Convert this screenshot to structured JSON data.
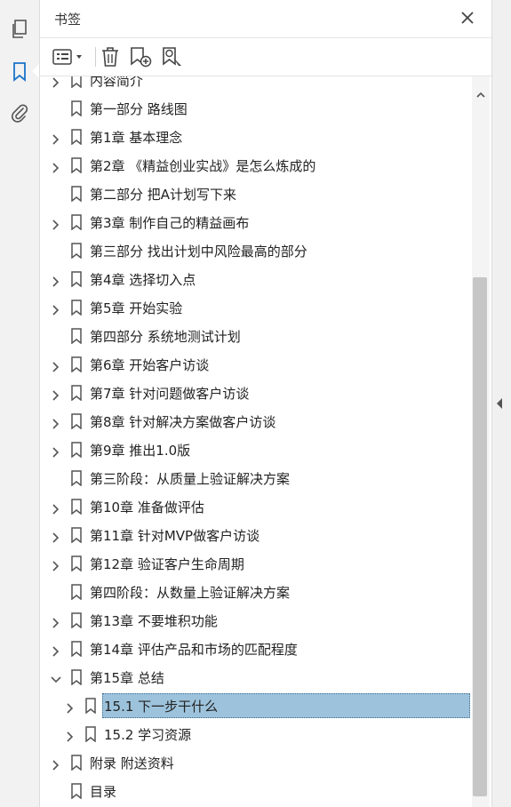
{
  "panel": {
    "title": "书签"
  },
  "rail": {
    "icons": [
      "pages-icon",
      "bookmark-icon",
      "attachment-icon"
    ],
    "active": "bookmark-icon"
  },
  "toolbar": {
    "icons": [
      "options-menu-icon",
      "delete-icon",
      "new-bookmark-icon",
      "find-bookmark-icon"
    ]
  },
  "colors": {
    "accent": "#1a73c9",
    "selected_bg": "#9dc3dc"
  },
  "bookmarks": [
    {
      "label": "内容简介",
      "expandable": true,
      "expanded": false,
      "level": 0
    },
    {
      "label": "第一部分 路线图",
      "expandable": false,
      "level": 0
    },
    {
      "label": "第1章 基本理念",
      "expandable": true,
      "expanded": false,
      "level": 0
    },
    {
      "label": "第2章 《精益创业实战》是怎么炼成的",
      "expandable": true,
      "expanded": false,
      "level": 0
    },
    {
      "label": "第二部分 把A计划写下来",
      "expandable": false,
      "level": 0
    },
    {
      "label": "第3章 制作自己的精益画布",
      "expandable": true,
      "expanded": false,
      "level": 0
    },
    {
      "label": "第三部分 找出计划中风险最高的部分",
      "expandable": false,
      "level": 0
    },
    {
      "label": "第4章 选择切入点",
      "expandable": true,
      "expanded": false,
      "level": 0
    },
    {
      "label": "第5章 开始实验",
      "expandable": true,
      "expanded": false,
      "level": 0
    },
    {
      "label": "第四部分 系统地测试计划",
      "expandable": false,
      "level": 0
    },
    {
      "label": "第6章 开始客户访谈",
      "expandable": true,
      "expanded": false,
      "level": 0
    },
    {
      "label": "第7章 针对问题做客户访谈",
      "expandable": true,
      "expanded": false,
      "level": 0
    },
    {
      "label": "第8章 针对解决方案做客户访谈",
      "expandable": true,
      "expanded": false,
      "level": 0
    },
    {
      "label": "第9章 推出1.0版",
      "expandable": true,
      "expanded": false,
      "level": 0
    },
    {
      "label": "第三阶段：从质量上验证解决方案",
      "expandable": false,
      "level": 0
    },
    {
      "label": "第10章 准备做评估",
      "expandable": true,
      "expanded": false,
      "level": 0
    },
    {
      "label": "第11章 针对MVP做客户访谈",
      "expandable": true,
      "expanded": false,
      "level": 0
    },
    {
      "label": "第12章 验证客户生命周期",
      "expandable": true,
      "expanded": false,
      "level": 0
    },
    {
      "label": "第四阶段：从数量上验证解决方案",
      "expandable": false,
      "level": 0
    },
    {
      "label": "第13章 不要堆积功能",
      "expandable": true,
      "expanded": false,
      "level": 0
    },
    {
      "label": "第14章 评估产品和市场的匹配程度",
      "expandable": true,
      "expanded": false,
      "level": 0
    },
    {
      "label": "第15章 总结",
      "expandable": true,
      "expanded": true,
      "level": 0
    },
    {
      "label": "15.1 下一步干什么",
      "expandable": true,
      "expanded": false,
      "level": 1,
      "selected": true
    },
    {
      "label": "15.2 学习资源",
      "expandable": true,
      "expanded": false,
      "level": 1
    },
    {
      "label": "附录 附送资料",
      "expandable": true,
      "expanded": false,
      "level": 0
    },
    {
      "label": "目录",
      "expandable": false,
      "level": 0
    }
  ]
}
